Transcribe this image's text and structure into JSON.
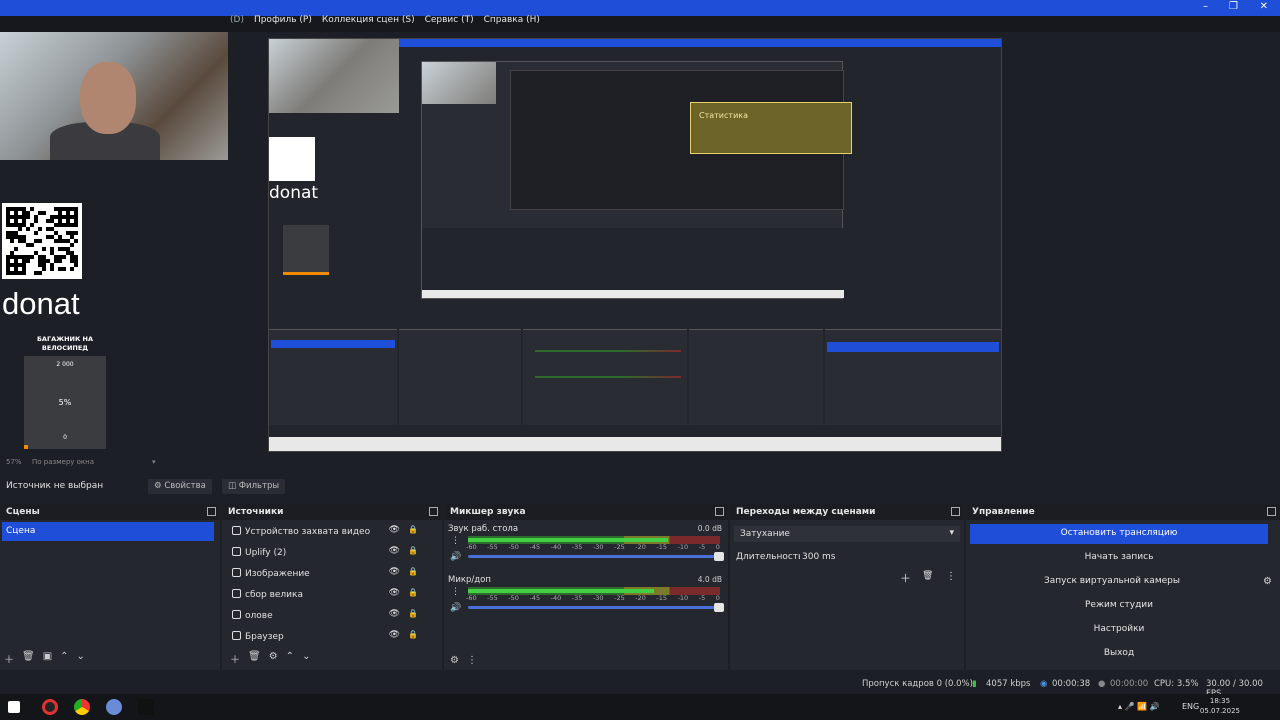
{
  "menu": {
    "items": [
      "(D)",
      "Профиль (Р)",
      "Коллекция сцен (S)",
      "Сервис (T)",
      "Справка (H)"
    ]
  },
  "preview": {
    "donat_text": "donat",
    "goal_title": "БАГАЖНИК НА ВЕЛОСИПЕД",
    "goal_max": "2 000",
    "goal_percent": "5%",
    "goal_min": "0",
    "goal_progress": 0.05,
    "nested_donat_text": "donat",
    "nested_stats_title": "Статистика"
  },
  "zoom": {
    "value": "57%",
    "mode": "По размеру окна"
  },
  "source_row": {
    "label": "Источник не выбран",
    "properties_button": "Свойства",
    "filters_button": "Фильтры"
  },
  "scenes": {
    "title": "Сцены",
    "items": [
      "Сцена"
    ]
  },
  "sources": {
    "title": "Источники",
    "items": [
      "Устройство захвата видео",
      "Uplify (2)",
      "Изображение",
      "сбор велика",
      "олове",
      "Браузер"
    ]
  },
  "mixer": {
    "title": "Микшер звука",
    "ticks": [
      "-60",
      "-55",
      "-50",
      "-45",
      "-40",
      "-35",
      "-30",
      "-25",
      "-20",
      "-15",
      "-10",
      "-5",
      "0"
    ],
    "channels": [
      {
        "name": "Звук раб. стола",
        "db": "0.0 dB"
      },
      {
        "name": "Микр/доп",
        "db": "4.0 dB"
      }
    ]
  },
  "transitions": {
    "title": "Переходы между сценами",
    "selected": "Затухание",
    "duration_label": "Длительность",
    "duration_value": "300 ms"
  },
  "controls": {
    "title": "Управление",
    "stop_stream": "Остановить трансляцию",
    "start_record": "Начать запись",
    "virtual_cam": "Запуск виртуальной камеры",
    "studio_mode": "Режим студии",
    "settings": "Настройки",
    "exit": "Выход"
  },
  "status": {
    "dropped": "Пропуск кадров 0 (0.0%)",
    "bitrate": "4057 kbps",
    "stream_time": "00:00:38",
    "rec_time": "00:00:00",
    "cpu": "CPU: 3.5%",
    "fps": "30.00 / 30.00 FPS"
  },
  "taskbar": {
    "lang": "ENG",
    "time": "18:35",
    "date": "05.07.2025"
  },
  "colors": {
    "accent": "#1f4fd8",
    "panel": "#25272e",
    "background": "#1d1f26"
  }
}
